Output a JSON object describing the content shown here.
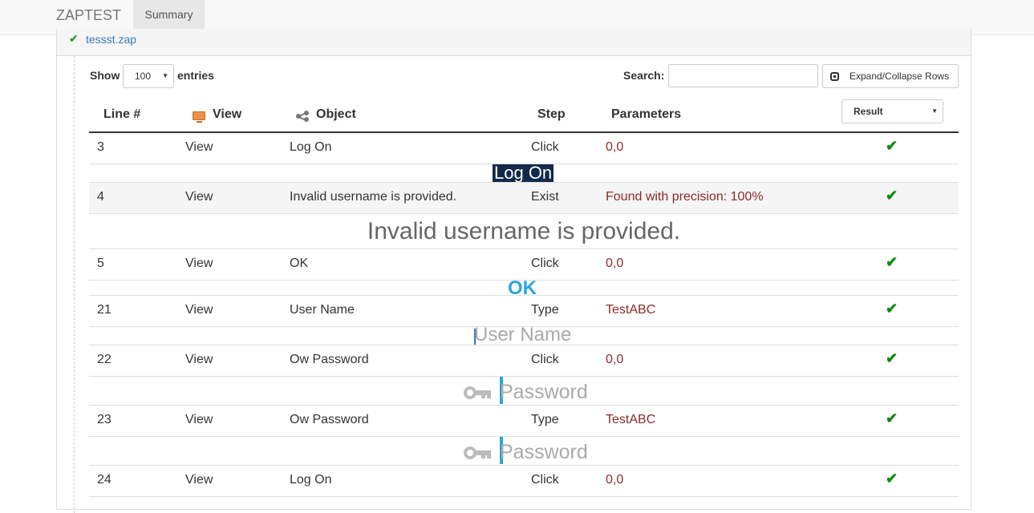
{
  "nav": {
    "brand": "ZAPTEST",
    "tab_summary": "Summary"
  },
  "file": {
    "name": "tessst.zap"
  },
  "controls": {
    "show_label": "Show",
    "entries_value": "100",
    "entries_label": "entries",
    "search_label": "Search:",
    "search_value": "",
    "expand_label": "Expand/Collapse Rows"
  },
  "table": {
    "headers": {
      "line": "Line #",
      "view": "View",
      "object": "Object",
      "step": "Step",
      "parameters": "Parameters",
      "result": "Result"
    },
    "rows": [
      {
        "line": "3",
        "view": "View",
        "object": "Log On",
        "step": "Click",
        "parameters": "0,0"
      },
      {
        "line": "4",
        "view": "View",
        "object": "Invalid username is provided.",
        "step": "Exist",
        "parameters": "Found with precision: 100%"
      },
      {
        "line": "5",
        "view": "View",
        "object": "OK",
        "step": "Click",
        "parameters": "0,0"
      },
      {
        "line": "21",
        "view": "View",
        "object": "User Name",
        "step": "Type",
        "parameters": "TestABC"
      },
      {
        "line": "22",
        "view": "View",
        "object": "Ow Password",
        "step": "Click",
        "parameters": "0,0"
      },
      {
        "line": "23",
        "view": "View",
        "object": "Ow Password",
        "step": "Type",
        "parameters": "TestABC"
      },
      {
        "line": "24",
        "view": "View",
        "object": "Log On",
        "step": "Click",
        "parameters": "0,0"
      }
    ]
  },
  "previews": {
    "logon": "Log On",
    "invalid": "Invalid username is provided.",
    "ok": "OK",
    "user_name": "User Name",
    "password": "Password"
  },
  "colors": {
    "pass": "#118a11",
    "param": "#8b2a2a",
    "accent": "#2aa6dd"
  }
}
